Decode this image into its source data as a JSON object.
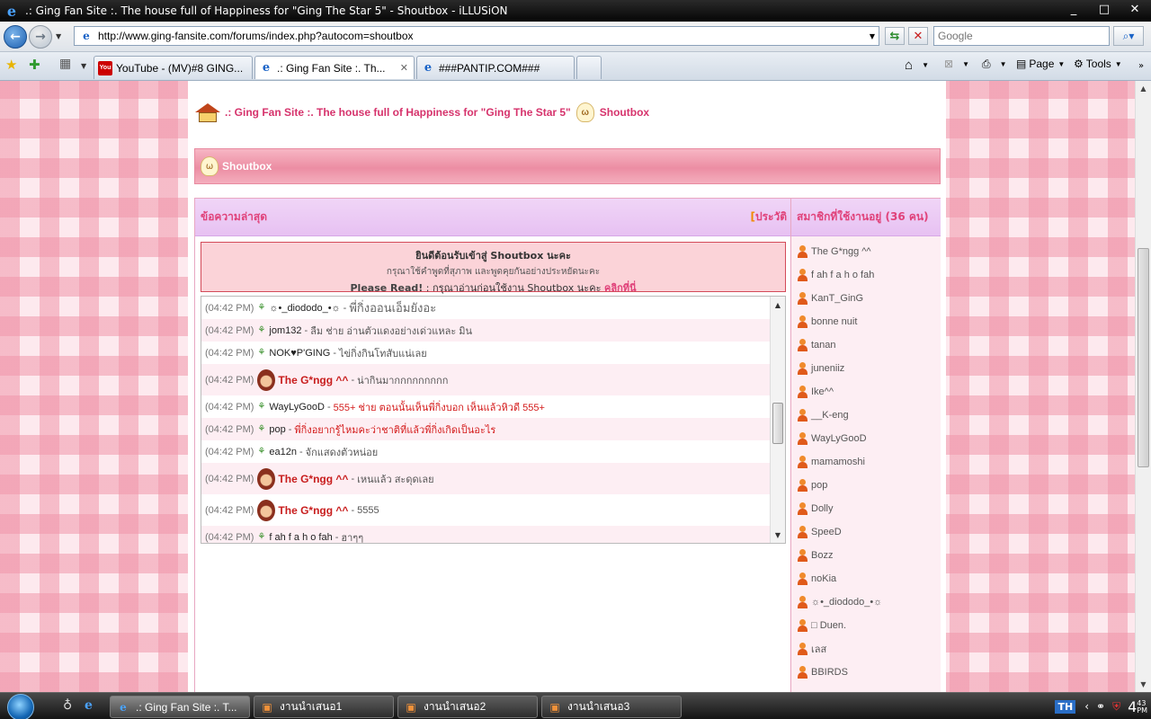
{
  "window": {
    "title": ".: Ging Fan Site :. The house full of Happiness for \"Ging The Star 5\" - Shoutbox - iLLUSiON",
    "controls": [
      "_",
      "□",
      "✕"
    ]
  },
  "address": {
    "url": "http://www.ging-fansite.com/forums/index.php?autocom=shoutbox",
    "search_placeholder": "Google"
  },
  "tabs": [
    {
      "label": "YouTube - (MV)#8 GING...",
      "icon": "youtube-icon"
    },
    {
      "label": ".: Ging Fan Site :. Th...",
      "icon": "ie-icon",
      "active": true
    },
    {
      "label": "###PANTIP.COM###",
      "icon": "ie-icon"
    }
  ],
  "commandbar": {
    "page": "Page",
    "tools": "Tools"
  },
  "breadcrumb": {
    "site": ".: Ging Fan Site :. The house full of Happiness for \"Ging The Star 5\"",
    "section": "Shoutbox"
  },
  "shoutbox": {
    "header": "Shoutbox",
    "latest_title": "ข้อความล่าสุด",
    "history_bracket": "[",
    "history_label": "ประวัติ",
    "welcome": {
      "line1": "ยินดีต้อนรับเข้าสู่ Shoutbox นะคะ",
      "line2": "กรุณาใช้คำพูดที่สุภาพ และพูดคุยกันอย่างประหยัดนะคะ",
      "line3_prefix": "Please Read!",
      "line3_text": " : กรุณาอ่านก่อนใช้งาน Shoutbox นะคะ ",
      "line3_link": "คลิกที่นี่"
    },
    "messages": [
      {
        "time": "(04:42 PM)",
        "name": "☼•_diododo_•☼",
        "text": "พี่กิ่งออนเอ็มยังอะ",
        "style": "big"
      },
      {
        "time": "(04:42 PM)",
        "name": "jom132",
        "text": "ลืม ช่าย อ่านตัวแดงอย่างเด่วแหละ มิน"
      },
      {
        "time": "(04:42 PM)",
        "name": "NOK♥P'GING",
        "text": "ไข่กิ่งกินโทสับแน่เลย"
      },
      {
        "time": "(04:42 PM)",
        "name": "The G*ngg ^^",
        "text": "น่ากินมากกกกกกกกก",
        "special": true
      },
      {
        "time": "(04:42 PM)",
        "name": "WayLyGooD",
        "text": "555+ ช่าย ตอนนั้นเห็นพี่กิ่งบอก เห็นแล้วหิวดี 555+",
        "style": "red"
      },
      {
        "time": "(04:42 PM)",
        "name": "pop",
        "text": "พี่กิ่งอยากรู้ไหมคะว่าชาติที่แล้วพี่กิ่งเกิดเป็นอะไร",
        "style": "red"
      },
      {
        "time": "(04:42 PM)",
        "name": "ea12n",
        "text": "จักแสดงตัวหน่อย"
      },
      {
        "time": "(04:42 PM)",
        "name": "The G*ngg ^^",
        "text": "เหนแล้ว สะดุดเลย",
        "special": true
      },
      {
        "time": "(04:42 PM)",
        "name": "The G*ngg ^^",
        "text": "5555",
        "special": true
      },
      {
        "time": "(04:42 PM)",
        "name": "f ah f a h o fah",
        "text": "ฮาๆๆ"
      }
    ],
    "online_title": "สมาชิกที่ใช้งานอยู่ (36 คน)",
    "online_users": [
      "The G*ngg ^^",
      "f ah f a h o fah",
      "KanT_GinG",
      "bonne nuit",
      "tanan",
      "juneniiz",
      "Ike^^",
      "__K-eng",
      "WayLyGooD",
      "mamamoshi",
      "pop",
      "Dolly",
      "SpeeD",
      "Bozz",
      "noKia",
      "☼•_diododo_•☼",
      "□ Duen.",
      "เลส",
      "BBIRDS"
    ]
  },
  "taskbar": {
    "tasks": [
      {
        "label": ".: Ging Fan Site :. T...",
        "icon": "ie-icon",
        "active": true
      },
      {
        "label": "งานนำเสนอ1",
        "icon": "powerpoint-icon"
      },
      {
        "label": "งานนำเสนอ2",
        "icon": "powerpoint-icon"
      },
      {
        "label": "งานนำเสนอ3",
        "icon": "powerpoint-icon"
      }
    ],
    "language": "TH",
    "clock_hour": "4",
    "clock_minutes": "43",
    "clock_ampm": "PM"
  },
  "colors": {
    "accent_pink": "#e0427a",
    "special_red": "#c81d1d",
    "header_pink": "#ec8da3",
    "history_orange": "#f18a00"
  }
}
